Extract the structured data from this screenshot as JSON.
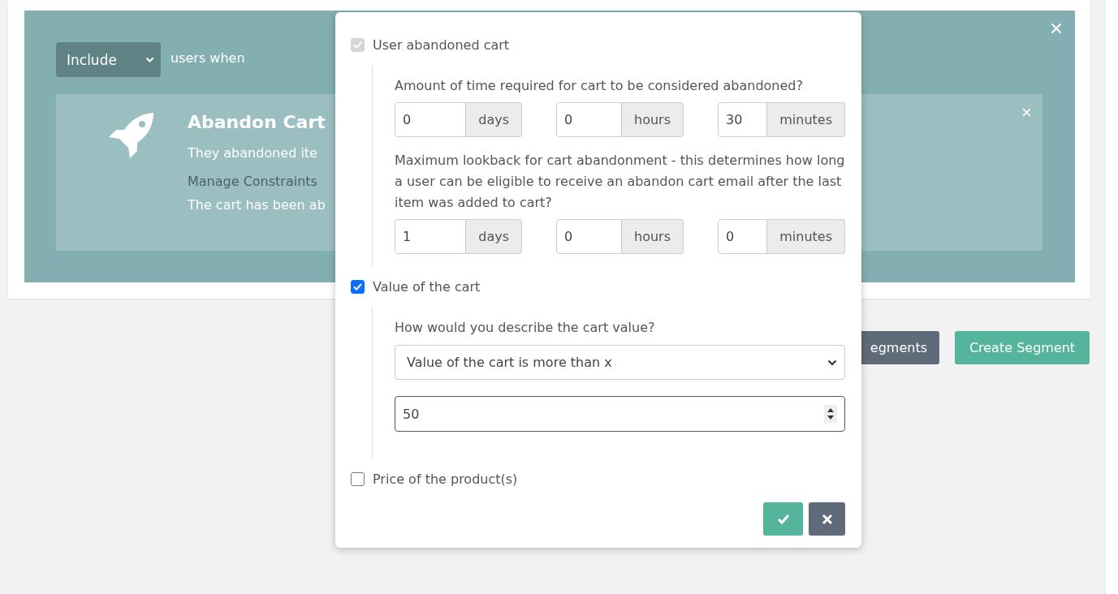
{
  "filter": {
    "mode": "Include",
    "suffix": "users when"
  },
  "rule_card": {
    "title": "Abandon Cart",
    "description": "They abandoned ite",
    "constraints_heading": "Manage Constraints",
    "constraint_summary": "The cart has been ab"
  },
  "buttons": [
    {
      "label": "egments",
      "kind": "secondary"
    },
    {
      "label": "Create Segment",
      "kind": "primary"
    }
  ],
  "modal": {
    "options": [
      {
        "label": "User abandoned cart",
        "checked": true,
        "disabled": true,
        "fields": [
          {
            "kind": "duration",
            "question": "Amount of time required for cart to be considered abandoned?",
            "parts": [
              {
                "value": "0",
                "unit": "days"
              },
              {
                "value": "0",
                "unit": "hours"
              },
              {
                "value": "30",
                "unit": "minutes"
              }
            ]
          },
          {
            "kind": "duration",
            "question": "Maximum lookback for cart abandonment - this determines how long a user can be eligible to receive an abandon cart email after the last item was added to cart?",
            "parts": [
              {
                "value": "1",
                "unit": "days"
              },
              {
                "value": "0",
                "unit": "hours"
              },
              {
                "value": "0",
                "unit": "minutes"
              }
            ]
          }
        ]
      },
      {
        "label": "Value of the cart",
        "checked": true,
        "disabled": false,
        "fields": [
          {
            "kind": "select",
            "question": "How would you describe the cart value?",
            "value": "Value of the cart is more than x"
          },
          {
            "kind": "number",
            "value": "50"
          }
        ]
      },
      {
        "label": "Price of the product(s)",
        "checked": false,
        "disabled": false
      }
    ],
    "actions": [
      {
        "kind": "confirm"
      },
      {
        "kind": "cancel"
      }
    ]
  }
}
